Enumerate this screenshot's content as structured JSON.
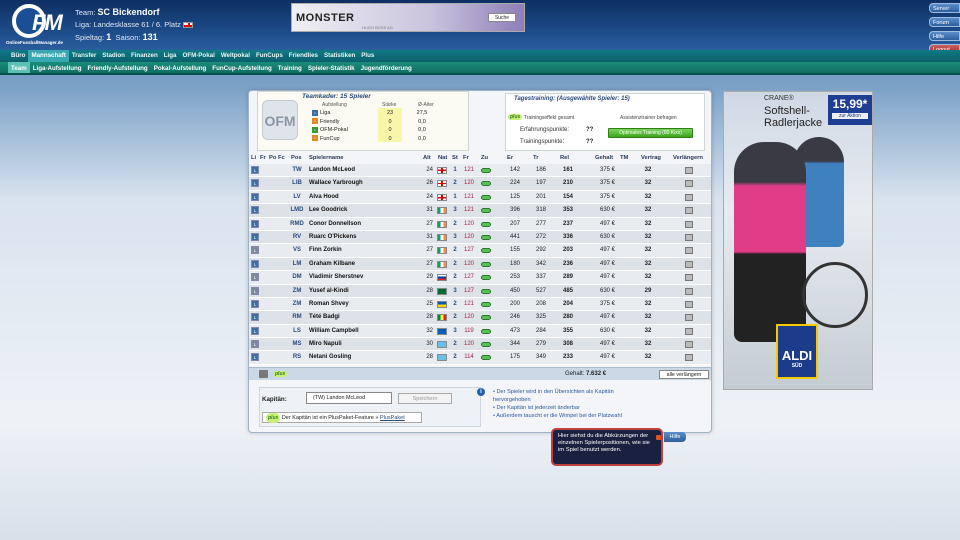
{
  "header": {
    "logo_sub": "OnlineFussballManager.de",
    "team_label": "Team:",
    "team_name": "SC Bickendorf",
    "liga_line": "Liga: Landesklasse 61  /  6. Platz",
    "spieltag_label": "Spieltag:",
    "spieltag": "1",
    "saison_label": "Saison:",
    "saison": "131"
  },
  "banner": {
    "brand": "MONSTER",
    "sub": "HUGO BOSS AG",
    "search": "Suche"
  },
  "side_buttons": [
    "Server",
    "Forum",
    "Hilfe",
    "Logout"
  ],
  "nav_main": [
    "Büro",
    "Mannschaft",
    "Transfer",
    "Stadion",
    "Finanzen",
    "Liga",
    "OFM-Pokal",
    "Weltpokal",
    "FunCups",
    "Friendlies",
    "Statistiken",
    "Plus"
  ],
  "nav_sub": [
    "Team",
    "Liga-Aufstellung",
    "Friendly-Aufstellung",
    "Pokal-Aufstellung",
    "FunCup-Aufstellung",
    "Training",
    "Spieler-Statistik",
    "Jugendförderung"
  ],
  "teamkader": {
    "title": "Teamkader: 15 Spieler",
    "col_aufstellung": "Aufstellung",
    "col_staerke": "Stärke",
    "col_alter": "Ø-Alter",
    "rows": [
      {
        "name": "Liga",
        "staerke": "23",
        "alter": "27,5"
      },
      {
        "name": "Friendly",
        "staerke": "0",
        "alter": "0,0"
      },
      {
        "name": "OFM-Pokal",
        "staerke": "0",
        "alter": "0,0"
      },
      {
        "name": "FunCup",
        "staerke": "0",
        "alter": "0,0"
      }
    ]
  },
  "tagestraining": {
    "title": "Tagestraining: (Ausgewählte Spieler: 15)",
    "col1": "Trainingseffekt gesamt",
    "col2": "Assistenztrainer befragen",
    "erfahrung_label": "Erfahrungspunkte:",
    "erfahrung_val": "??",
    "training_label": "Trainingspunkte:",
    "training_val": "??",
    "button": "Optimales Training (80 Kixx)",
    "plus": "plus"
  },
  "columns": [
    "Li",
    "Fr",
    "Po",
    "Fc",
    "Pos",
    "Spielername",
    "Alt",
    "Nat",
    "St",
    "Fr",
    "Zu",
    "Er",
    "Tr",
    "Rel",
    "Gehalt",
    "TM",
    "Vertrag",
    "Verlängern"
  ],
  "players": [
    {
      "pos": "TW",
      "name": "Landon McLeod",
      "alt": "24",
      "nat": "eng",
      "st": "1",
      "fr": "121",
      "er": "142",
      "tr": "186",
      "rel": "161",
      "gehalt": "375 €",
      "vertrag": "32"
    },
    {
      "pos": "LIB",
      "name": "Wallace Yarbrough",
      "alt": "26",
      "nat": "eng",
      "st": "2",
      "fr": "120",
      "er": "224",
      "tr": "197",
      "rel": "210",
      "gehalt": "375 €",
      "vertrag": "32"
    },
    {
      "pos": "LV",
      "name": "Alva Hood",
      "alt": "24",
      "nat": "eng",
      "st": "1",
      "fr": "121",
      "er": "125",
      "tr": "201",
      "rel": "154",
      "gehalt": "375 €",
      "vertrag": "32"
    },
    {
      "pos": "LMD",
      "name": "Lee Goodrick",
      "alt": "31",
      "nat": "irl",
      "st": "3",
      "fr": "121",
      "er": "396",
      "tr": "318",
      "rel": "353",
      "gehalt": "630 €",
      "vertrag": "32"
    },
    {
      "pos": "RMD",
      "name": "Conor Donnellson",
      "alt": "27",
      "nat": "irl",
      "st": "2",
      "fr": "120",
      "er": "207",
      "tr": "277",
      "rel": "237",
      "gehalt": "497 €",
      "vertrag": "32"
    },
    {
      "pos": "RV",
      "name": "Ruarc O'Pickens",
      "alt": "31",
      "nat": "irl",
      "st": "3",
      "fr": "120",
      "er": "441",
      "tr": "272",
      "rel": "336",
      "gehalt": "630 €",
      "vertrag": "32"
    },
    {
      "pos": "VS",
      "name": "Finn Zorkin",
      "alt": "27",
      "nat": "irl",
      "st": "2",
      "fr": "127",
      "er": "155",
      "tr": "292",
      "rel": "203",
      "gehalt": "497 €",
      "vertrag": "32"
    },
    {
      "pos": "LM",
      "name": "Graham Kilbane",
      "alt": "27",
      "nat": "irl",
      "st": "2",
      "fr": "120",
      "er": "180",
      "tr": "342",
      "rel": "236",
      "gehalt": "497 €",
      "vertrag": "32"
    },
    {
      "pos": "DM",
      "name": "Vladimir Sherstnev",
      "alt": "29",
      "nat": "rus",
      "st": "2",
      "fr": "127",
      "er": "253",
      "tr": "337",
      "rel": "289",
      "gehalt": "497 €",
      "vertrag": "32"
    },
    {
      "pos": "ZM",
      "name": "Yusef al-Kindi",
      "alt": "28",
      "nat": "sau",
      "st": "3",
      "fr": "127",
      "er": "450",
      "tr": "527",
      "rel": "485",
      "gehalt": "630 €",
      "vertrag": "29"
    },
    {
      "pos": "ZM",
      "name": "Roman Shvey",
      "alt": "25",
      "nat": "ukr",
      "st": "2",
      "fr": "121",
      "er": "200",
      "tr": "208",
      "rel": "204",
      "gehalt": "375 €",
      "vertrag": "32"
    },
    {
      "pos": "RM",
      "name": "Tété Badgi",
      "alt": "28",
      "nat": "sen",
      "st": "2",
      "fr": "120",
      "er": "246",
      "tr": "325",
      "rel": "280",
      "gehalt": "497 €",
      "vertrag": "32"
    },
    {
      "pos": "LS",
      "name": "William Campbell",
      "alt": "32",
      "nat": "sco",
      "st": "3",
      "fr": "119",
      "er": "473",
      "tr": "284",
      "rel": "355",
      "gehalt": "630 €",
      "vertrag": "32"
    },
    {
      "pos": "MS",
      "name": "Miro Napuli",
      "alt": "30",
      "nat": "fij",
      "st": "2",
      "fr": "120",
      "er": "344",
      "tr": "279",
      "rel": "308",
      "gehalt": "497 €",
      "vertrag": "32"
    },
    {
      "pos": "RS",
      "name": "Netani Gosling",
      "alt": "28",
      "nat": "fij",
      "st": "2",
      "fr": "114",
      "er": "175",
      "tr": "349",
      "rel": "233",
      "gehalt": "497 €",
      "vertrag": "32"
    }
  ],
  "footer": {
    "gehalt_label": "Gehalt:",
    "gehalt_total": "7.632 €",
    "verlaengern_btn": "alle verlängern",
    "plus": "plus"
  },
  "kapitaen": {
    "label": "Kapitän:",
    "selected": "(TW) Landon McLeod",
    "save": "Speichern",
    "plus_text": "Der Kapitän ist ein PlusPaket-Feature »",
    "plus_link": "PlusPaket",
    "info": [
      "• Der Spieler wird in den Übersichten als Kapitän",
      "  hervorgehoben",
      "• Der Kapitän ist jederzeit änderbar",
      "• Außerdem tauscht er die Wimpel bei der Platzwahl"
    ]
  },
  "ad": {
    "brand": "CRANE®",
    "product": "Softshell-",
    "product2": "Radlerjacke",
    "price": "15,99*",
    "cta": "zur Aktion",
    "store": "ALDI",
    "store_sub": "SÜD"
  },
  "help": {
    "tip": "Hier siehst du die Abkürzungen der einzelnen Spielerpositionen, wie sie im Spiel benutzt werden.",
    "button": "Hilfe"
  },
  "colors": {
    "nav1": "#0f7a86",
    "nav2": "#1b8c7a",
    "header": "#1c4a87"
  }
}
